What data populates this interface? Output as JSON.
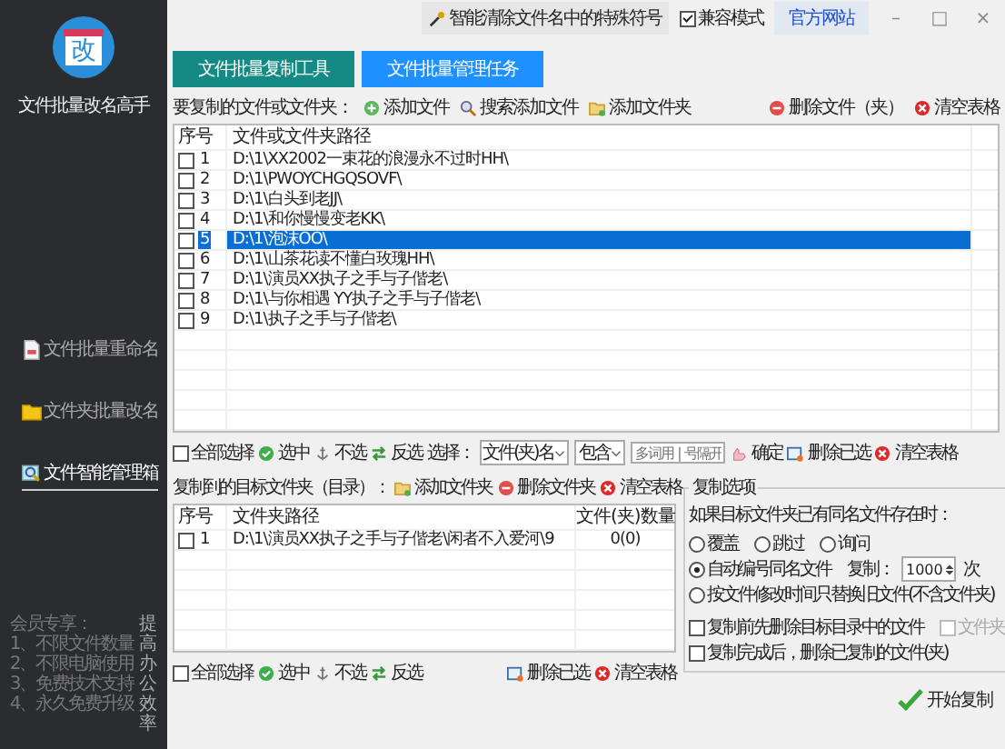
{
  "sidebar": {
    "logo_char": "改",
    "app_title": "文件批量改名高手",
    "nav": [
      {
        "label": "文件批量重命名",
        "selected": false
      },
      {
        "label": "文件夹批量改名",
        "selected": false
      },
      {
        "label": "文件智能管理箱",
        "selected": true
      }
    ],
    "promo": {
      "heading": "会员专享：",
      "lines": [
        "1、不限文件数量",
        "2、不限电脑使用",
        "3、免费技术支持",
        "4、永久免费升级"
      ],
      "slogan": "提高办公效率"
    }
  },
  "top_bar": {
    "clean_button": "智能清除文件名中的特殊符号",
    "compat_mode": {
      "label": "兼容模式",
      "checked": true
    },
    "website_link": "官方网站",
    "window_controls": [
      "–",
      "□",
      "×"
    ]
  },
  "tool_tabs": [
    {
      "label": "文件批量复制工具",
      "selected": true
    },
    {
      "label": "文件批量管理任务",
      "selected": false
    }
  ],
  "source": {
    "label": "要复制的文件或文件夹：",
    "actions": [
      "添加文件",
      "搜索添加文件",
      "添加文件夹"
    ],
    "right_actions": [
      "删除文件（夹）",
      "清空表格"
    ],
    "table": {
      "columns": [
        "序号",
        "文件或文件夹路径"
      ],
      "rows": [
        {
          "index": "1",
          "path": "D:\\1\\XX2002一束花的浪漫永不过时HH\\",
          "checked": false,
          "selected": false
        },
        {
          "index": "2",
          "path": "D:\\1\\PWOYCHGQSOVF\\",
          "checked": false,
          "selected": false
        },
        {
          "index": "3",
          "path": "D:\\1\\白头到老JJ\\",
          "checked": false,
          "selected": false
        },
        {
          "index": "4",
          "path": "D:\\1\\和你慢慢变老KK\\",
          "checked": false,
          "selected": false
        },
        {
          "index": "5",
          "path": "D:\\1\\泡沫OO\\",
          "checked": false,
          "selected": true
        },
        {
          "index": "6",
          "path": "D:\\1\\山茶花读不懂白玫瑰HH\\",
          "checked": false,
          "selected": false
        },
        {
          "index": "7",
          "path": "D:\\1\\演员XX执子之手与子偕老\\",
          "checked": false,
          "selected": false
        },
        {
          "index": "8",
          "path": "D:\\1\\与你相遇 YY执子之手与子偕老\\",
          "checked": false,
          "selected": false
        },
        {
          "index": "9",
          "path": "D:\\1\\执子之手与子偕老\\",
          "checked": false,
          "selected": false
        }
      ]
    }
  },
  "selection_bar": {
    "select_all": {
      "label": "全部选择",
      "checked": false
    },
    "actions": [
      "选中",
      "不选",
      "反选"
    ],
    "filter_label": "选择：",
    "field_dropdown": "文件(夹)名",
    "mode_dropdown": "包含",
    "keyword": {
      "placeholder": "多词用 | 号隔开"
    },
    "confirm": "确定",
    "right_actions": [
      "删除已选",
      "清空表格"
    ]
  },
  "target": {
    "label": "复制到的目标文件夹（目录）：",
    "actions": [
      "添加文件夹",
      "删除文件夹",
      "清空表格"
    ],
    "table": {
      "columns": [
        "序号",
        "文件夹路径",
        "文件(夹)数量"
      ],
      "rows": [
        {
          "index": "1",
          "path": "D:\\1\\演员XX执子之手与子偕老\\闲者不入爱河\\9",
          "count": "0(0)",
          "checked": false
        }
      ]
    },
    "select_all": {
      "label": "全部选择",
      "checked": false
    },
    "bottom_actions": [
      "选中",
      "不选",
      "反选"
    ],
    "bottom_right_actions": [
      "删除已选",
      "清空表格"
    ]
  },
  "options": {
    "title": "复制选项",
    "prompt": "如果目标文件夹已有同名文件存在时：",
    "radio_rows": [
      [
        {
          "label": "覆盖",
          "selected": false
        },
        {
          "label": "跳过",
          "selected": false
        },
        {
          "label": "询问",
          "selected": false
        }
      ],
      [
        {
          "label": "自动编号同名文件",
          "selected": true
        }
      ],
      [
        {
          "label": "按文件修改时间只替换旧文件(不含文件夹)",
          "selected": false
        }
      ]
    ],
    "copies": {
      "label": "复制：",
      "value": "1000",
      "unit": "次"
    },
    "checkbox_rows": [
      [
        {
          "label": "复制前先删除目标目录中的文件",
          "checked": false,
          "disabled": false
        },
        {
          "label": "文件夹",
          "checked": false,
          "disabled": true
        }
      ],
      [
        {
          "label": "复制完成后，删除已复制的文件(夹)",
          "checked": false,
          "disabled": false
        }
      ]
    ]
  },
  "start_button": "开始复制"
}
